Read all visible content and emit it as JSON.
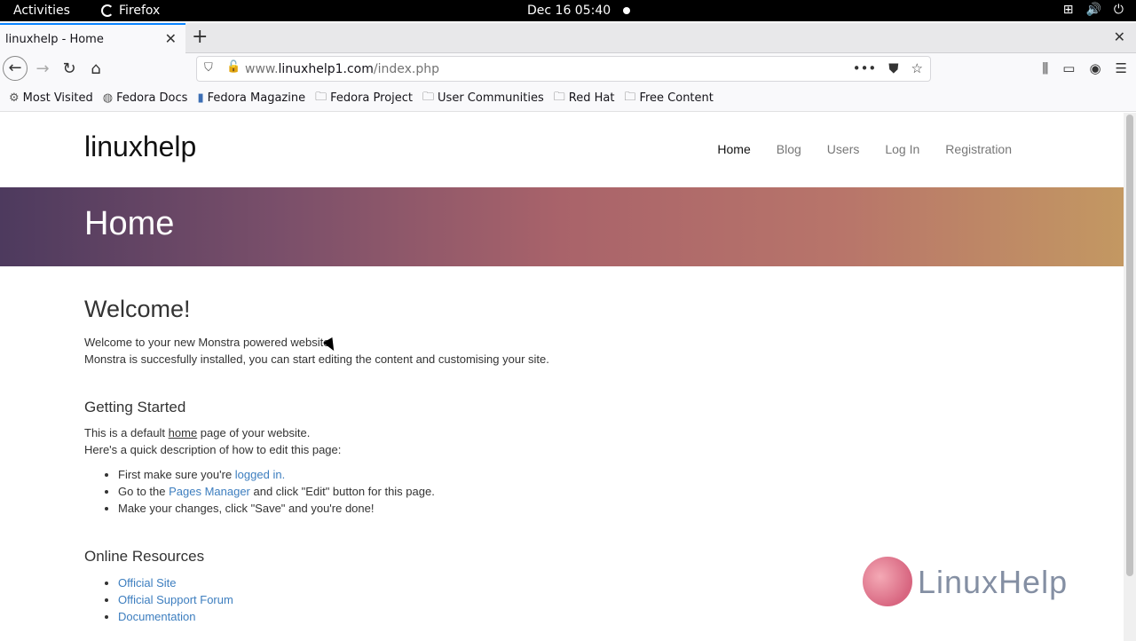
{
  "system_bar": {
    "activities": "Activities",
    "app_name": "Firefox",
    "clock": "Dec 16  05:40"
  },
  "browser": {
    "tab_title": "linuxhelp - Home",
    "url_host": "www.linuxhelp1.com",
    "url_path": "/index.php",
    "url_prefix": "www.",
    "url_domain": "linuxhelp1.com"
  },
  "bookmarks": [
    {
      "label": "Most Visited",
      "icon": "gear-icon"
    },
    {
      "label": "Fedora Docs",
      "icon": "globe-icon"
    },
    {
      "label": "Fedora Magazine",
      "icon": "fm-icon"
    },
    {
      "label": "Fedora Project",
      "icon": "folder-icon"
    },
    {
      "label": "User Communities",
      "icon": "folder-icon"
    },
    {
      "label": "Red Hat",
      "icon": "folder-icon"
    },
    {
      "label": "Free Content",
      "icon": "folder-icon"
    }
  ],
  "site": {
    "brand": "linuxhelp",
    "menu": [
      "Home",
      "Blog",
      "Users",
      "Log In",
      "Registration"
    ],
    "hero_title": "Home"
  },
  "content": {
    "welcome_title": "Welcome!",
    "welcome_line1": "Welcome to your new Monstra powered website.",
    "welcome_line2": "Monstra is succesfully installed, you can start editing the content and customising your site.",
    "getting_started_title": "Getting Started",
    "gs_line1_pre": "This is a default ",
    "gs_line1_link": "home",
    "gs_line1_post": " page of your website.",
    "gs_line2": "Here's a quick description of how to edit this page:",
    "steps": [
      {
        "pre": "First make sure you're ",
        "link": "logged in.",
        "post": ""
      },
      {
        "pre": "Go to the ",
        "link": "Pages Manager",
        "post": " and click \"Edit\" button for this page."
      },
      {
        "pre": "Make your changes, click \"Save\" and you're done!",
        "link": "",
        "post": ""
      }
    ],
    "resources_title": "Online Resources",
    "resources": [
      "Official Site",
      "Official Support Forum",
      "Documentation"
    ]
  },
  "watermark": "LinuxHelp"
}
